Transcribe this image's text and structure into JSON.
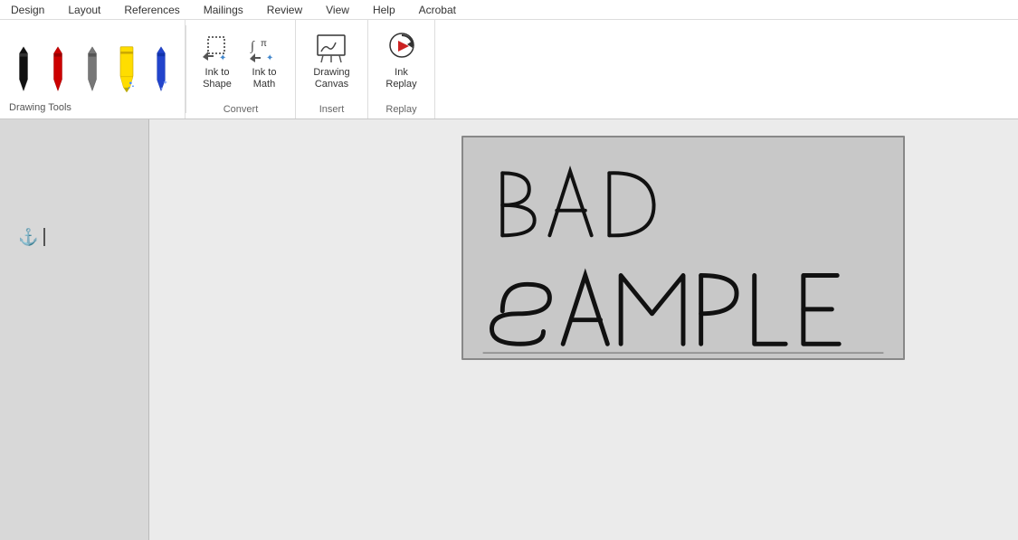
{
  "menubar": {
    "items": [
      "Design",
      "Layout",
      "References",
      "Mailings",
      "Review",
      "View",
      "Help",
      "Acrobat"
    ]
  },
  "ribbon": {
    "pens": [
      {
        "id": "pen-black",
        "color": "#111",
        "tip": "black"
      },
      {
        "id": "pen-red",
        "color": "#cc0000",
        "tip": "red"
      },
      {
        "id": "pen-gray",
        "color": "#888888",
        "tip": "gray"
      },
      {
        "id": "pen-yellow",
        "color": "#ffdd00",
        "tip": "yellow-highlighter"
      },
      {
        "id": "pen-blue",
        "color": "#2244cc",
        "tip": "blue-sparkle"
      }
    ],
    "drawing_tools_label": "Drawing Tools",
    "convert_section": {
      "label": "Convert",
      "buttons": [
        {
          "id": "ink-to-shape",
          "label": "Ink to\nShape"
        },
        {
          "id": "ink-to-math",
          "label": "Ink to\nMath"
        }
      ]
    },
    "insert_section": {
      "label": "Insert",
      "buttons": [
        {
          "id": "drawing-canvas",
          "label": "Drawing\nCanvas"
        }
      ]
    },
    "replay_section": {
      "label": "Replay",
      "buttons": [
        {
          "id": "ink-replay",
          "label": "Ink\nReplay"
        }
      ]
    }
  },
  "canvas": {
    "text": "BAD SAMPLE"
  }
}
